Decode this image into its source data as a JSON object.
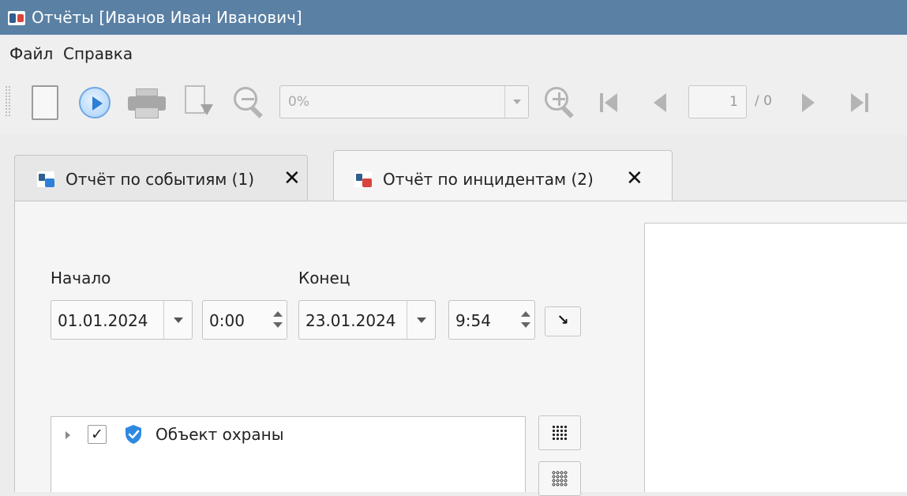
{
  "window": {
    "title": "Отчёты [Иванов Иван Иванович]"
  },
  "menu": {
    "items": [
      {
        "label": "Файл"
      },
      {
        "label": "Справка"
      }
    ]
  },
  "toolbar": {
    "zoom_value": "0%",
    "page_current": "1",
    "page_total": "/ 0"
  },
  "tabs": [
    {
      "label": "Отчёт по событиям (1)",
      "close": "✕",
      "icon": "events-report-icon"
    },
    {
      "label": "Отчёт по инцидентам (2)",
      "close": "✕",
      "icon": "incidents-report-icon"
    }
  ],
  "filter": {
    "start_label": "Начало",
    "end_label": "Конец",
    "start_date": "01.01.2024",
    "start_time": "0:00",
    "end_date": "23.01.2024",
    "end_time": "9:54",
    "apply_glyph": "↘"
  },
  "tree": {
    "items": [
      {
        "label": "Объект охраны",
        "checked": "✓"
      }
    ]
  },
  "colors": {
    "titlebar": "#5a80a4",
    "accent": "#2e7fd8"
  }
}
